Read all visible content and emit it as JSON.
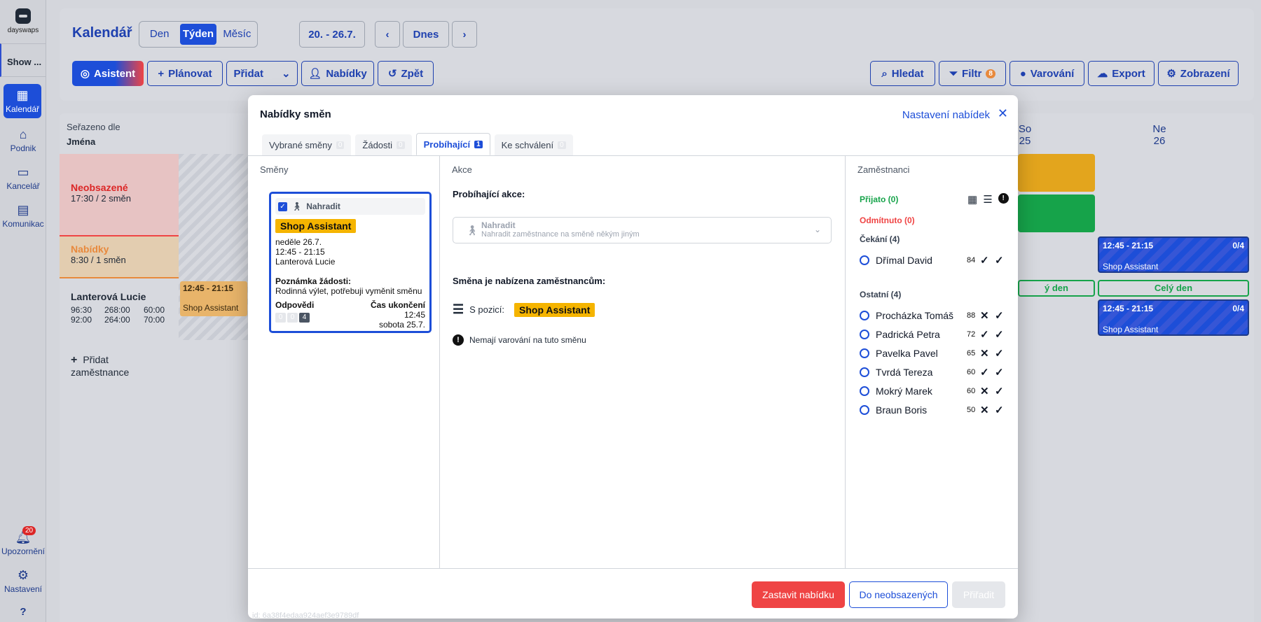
{
  "brand": {
    "name": "dayswaps"
  },
  "rail": {
    "show_label": "Show ...",
    "items": [
      {
        "label": "Kalendář",
        "icon": "calendar-icon"
      },
      {
        "label": "Podnik",
        "icon": "home-icon"
      },
      {
        "label": "Kancelář",
        "icon": "office-icon"
      },
      {
        "label": "Komunikac",
        "icon": "chat-icon"
      }
    ],
    "notifications": {
      "label": "Upozornění",
      "count": "20"
    },
    "settings": {
      "label": "Nastavení"
    },
    "help": "?"
  },
  "topbar": {
    "title": "Kalendář",
    "views": [
      "Den",
      "Týden",
      "Měsíc"
    ],
    "active_view": "Týden",
    "date_range": "20. - 26.7.",
    "prev": "‹",
    "next": "›",
    "today": "Dnes",
    "actions": {
      "assistant": "Asistent",
      "plan": "Plánovat",
      "add": "Přidat",
      "offers": "Nabídky",
      "back": "Zpět",
      "search": "Hledat",
      "filter": "Filtr",
      "filter_count": "8",
      "warnings": "Varování",
      "export": "Export",
      "display": "Zobrazení"
    }
  },
  "calendar": {
    "sorted_by_label": "Seřazeno dle",
    "sorted_by_value": "Jména",
    "rows": [
      {
        "title": "Neobsazené",
        "sub": "17:30 / 2 směn"
      },
      {
        "title": "Nabídky",
        "sub": "8:30 / 1 směn"
      },
      {
        "title": "Lanterová Lucie",
        "stats": [
          "96:30",
          "268:00",
          "60:00",
          "92:00",
          "264:00",
          "70:00"
        ]
      }
    ],
    "add_employee": "Přidat zaměstnance",
    "days": [
      {
        "name": "So",
        "num": "25"
      },
      {
        "name": "Ne",
        "num": "26"
      }
    ],
    "shifts": [
      {
        "time": "12:45 - 21:15",
        "position": "Shop Assistant",
        "count": "0/4"
      },
      {
        "time": "12:45 - 21:15",
        "position": "Shop Assistant",
        "count": "0/4"
      }
    ],
    "bg_shift": {
      "time": "12:45 - 21:15",
      "position": "Shop Assistant"
    },
    "allday": "Celý den",
    "allday_partial": "ý den"
  },
  "modal": {
    "title": "Nabídky směn",
    "settings_link": "Nastavení nabídek",
    "tabs": [
      {
        "label": "Vybrané směny",
        "count": "0"
      },
      {
        "label": "Žádosti",
        "count": "0"
      },
      {
        "label": "Probíhající",
        "count": "1"
      },
      {
        "label": "Ke schválení",
        "count": "0"
      }
    ],
    "shifts_col": {
      "header": "Směny",
      "card": {
        "type": "Nahradit",
        "position": "Shop Assistant",
        "date": "neděle 26.7.",
        "time": "12:45 - 21:15",
        "employee": "Lanterová Lucie",
        "note_label": "Poznámka žádosti:",
        "note": "Rodinná výlet, potřebuji vyměnit směnu",
        "answers_label": "Odpovědi",
        "answers": [
          "0",
          "0",
          "4"
        ],
        "end_label": "Čas ukončení",
        "end_time": "12:45",
        "end_date": "sobota 25.7."
      },
      "id": "id: 6a38f4edaa924aef3e9789df"
    },
    "action_col": {
      "header": "Akce",
      "current_label": "Probíhající akce:",
      "select_title": "Nahradit",
      "select_desc": "Nahradit zaměstnance na směně někým jiným",
      "offered_label": "Směna je nabízena zaměstnancům:",
      "with_position_label": "S pozicí:",
      "position": "Shop Assistant",
      "warning_text": "Nemají varování na tuto směnu"
    },
    "employees_col": {
      "header": "Zaměstnanci",
      "accepted": "Přijato (0)",
      "rejected": "Odmítnuto (0)",
      "waiting": "Čekání (4)",
      "others": "Ostatní (4)",
      "waiting_list": [
        {
          "name": "Dřímal David",
          "score": "84"
        }
      ],
      "others_list": [
        {
          "name": "Procházka Tomáš",
          "score": "88"
        },
        {
          "name": "Padrická Petra",
          "score": "72"
        },
        {
          "name": "Pavelka Pavel",
          "score": "65"
        },
        {
          "name": "Tvrdá Tereza",
          "score": "60"
        },
        {
          "name": "Mokrý Marek",
          "score": "60"
        },
        {
          "name": "Braun Boris",
          "score": "50"
        }
      ]
    },
    "footer": {
      "stop": "Zastavit nabídku",
      "to_unassigned": "Do neobsazených",
      "assign": "Přiřadit"
    }
  },
  "colors": {
    "primary": "#1d4ed8",
    "danger": "#ef4444",
    "accent": "#f5b400",
    "success": "#16a34a"
  }
}
